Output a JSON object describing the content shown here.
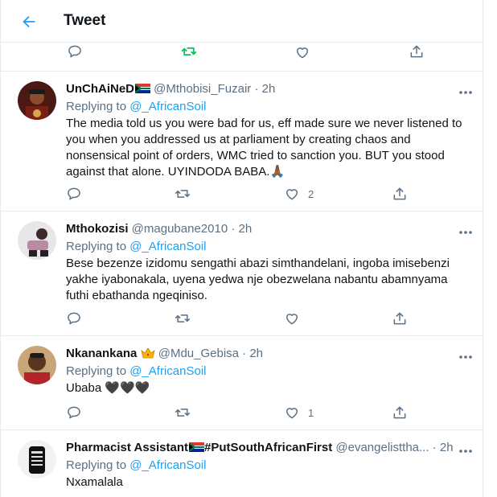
{
  "header": {
    "title": "Tweet"
  },
  "top_actions": [
    "reply-icon",
    "retweet-icon",
    "like-icon",
    "share-icon"
  ],
  "colors": {
    "accent": "#1da1f2",
    "retweet_green": "#17bf63",
    "muted": "#5b7083",
    "border": "#e6ecf0"
  },
  "replies": [
    {
      "name": "UnChAiNeD",
      "handle": "@Mthobisi_Fuzair",
      "time": "· 2h",
      "replying_prefix": "Replying to ",
      "replying_to": "@_AfricanSoil",
      "text": "The media told us you were bad for us, eff made sure we never listened to you when you addressed us at parliament by creating chaos and nonsensical point of orders, WMC tried to sanction you. BUT you stood against that alone. UYINDODA BABA.🙏🏾",
      "like_count": "2"
    },
    {
      "name": "Mthokozisi",
      "handle": "@magubane2010",
      "time": "· 2h",
      "replying_prefix": "Replying to ",
      "replying_to": "@_AfricanSoil",
      "text": "Bese bezenze izidomu sengathi abazi simthandelani, ingoba imisebenzi yakhe iyabonakala, uyena yedwa nje obezwelana nabantu abamnyama futhi ebathanda ngeqiniso."
    },
    {
      "name": "Nkanankana",
      "handle": "@Mdu_Gebisa",
      "time": "· 2h",
      "replying_prefix": "Replying to ",
      "replying_to": "@_AfricanSoil",
      "text": "Ubaba 🖤🖤🖤",
      "like_count": "1"
    },
    {
      "name": "Pharmacist Assistant",
      "name_suffix": "#PutSouthAfricanFirst",
      "handle": "@evangelisttha...",
      "time": "· 2h",
      "replying_prefix": "Replying to ",
      "replying_to": "@_AfricanSoil",
      "text": "Nxamalala"
    }
  ]
}
